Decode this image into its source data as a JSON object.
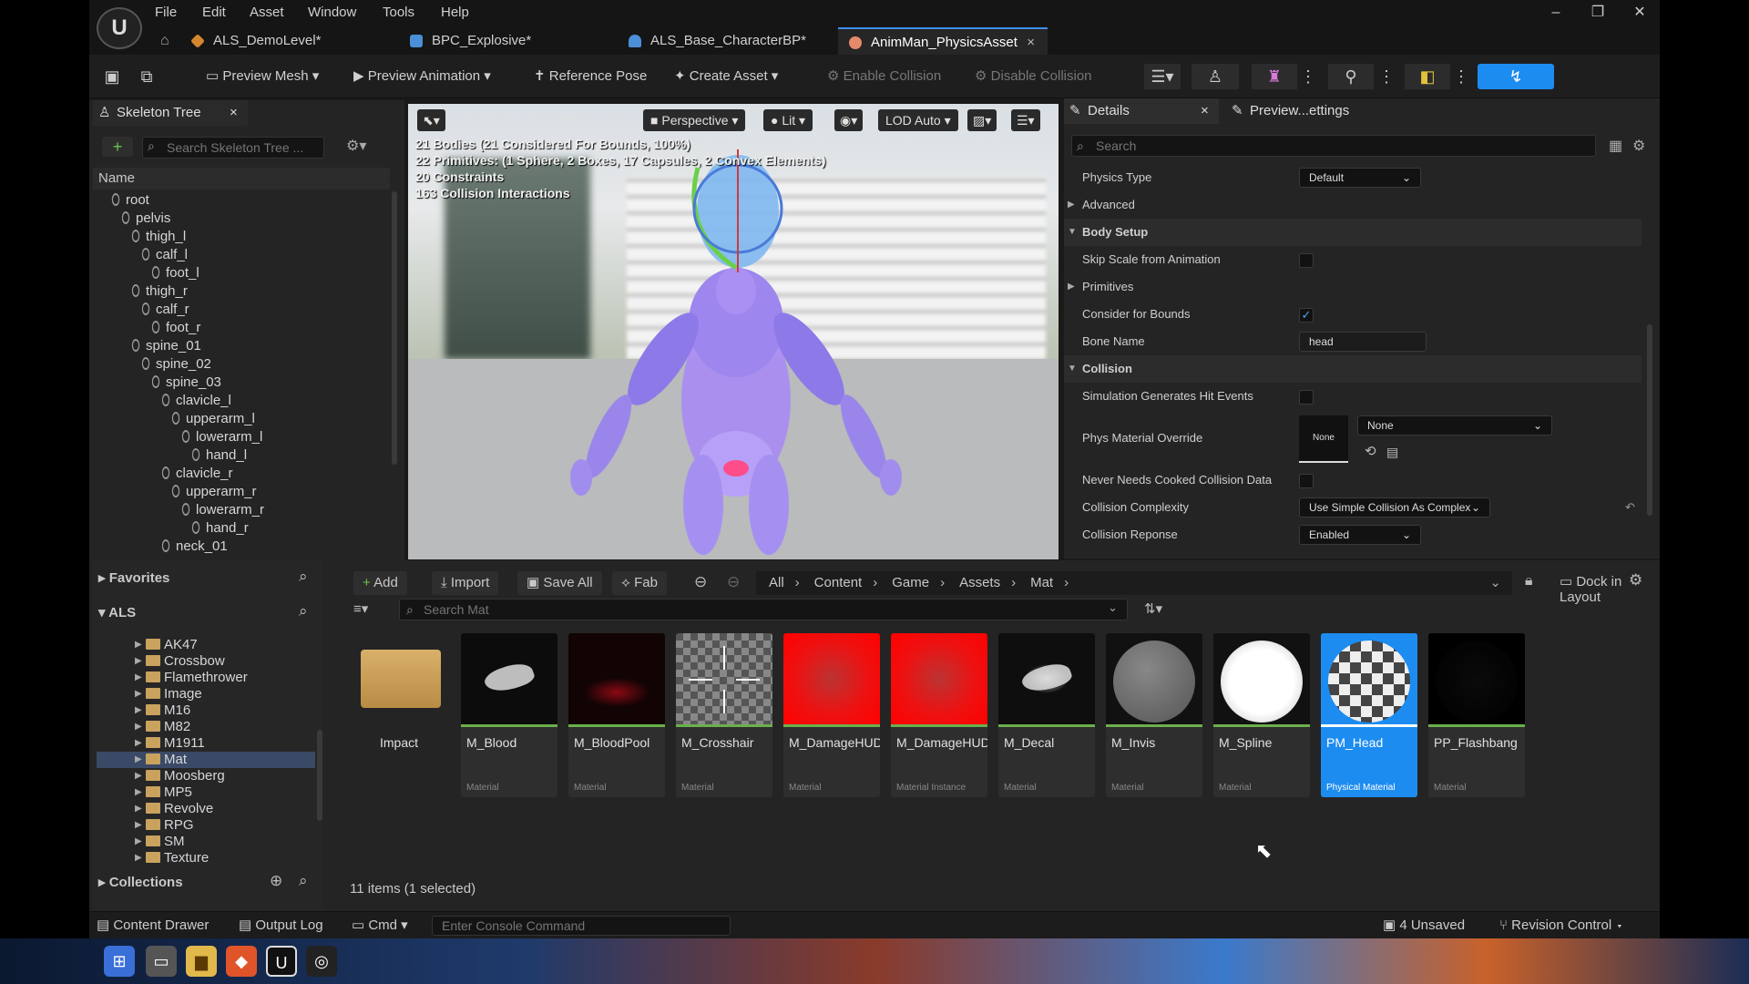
{
  "menu": [
    "File",
    "Edit",
    "Asset",
    "Window",
    "Tools",
    "Help"
  ],
  "logo_text": "U",
  "doc_tabs": [
    {
      "label": "ALS_DemoLevel*",
      "color": "#d4872e"
    },
    {
      "label": "BPC_Explosive*",
      "color": "#4a8fd8"
    },
    {
      "label": "ALS_Base_CharacterBP*",
      "color": "#4a8fd8"
    },
    {
      "label": "AnimMan_PhysicsAsset",
      "color": "#e58a6a",
      "active": true,
      "close": "×"
    }
  ],
  "window_controls": {
    "minimize": "–",
    "restore": "❐",
    "close": "✕"
  },
  "toolbar": {
    "preview_mesh": "Preview Mesh",
    "preview_animation": "Preview Animation",
    "reference_pose": "Reference Pose",
    "create_asset": "Create Asset",
    "enable_collision": "Enable Collision",
    "disable_collision": "Disable Collision"
  },
  "skeleton_tree": {
    "tab": "Skeleton Tree",
    "close": "×",
    "search_placeholder": "Search Skeleton Tree ...",
    "column_header": "Name",
    "bones": [
      {
        "name": "root",
        "depth": 0
      },
      {
        "name": "pelvis",
        "depth": 1
      },
      {
        "name": "thigh_l",
        "depth": 2
      },
      {
        "name": "calf_l",
        "depth": 3
      },
      {
        "name": "foot_l",
        "depth": 4
      },
      {
        "name": "thigh_r",
        "depth": 2
      },
      {
        "name": "calf_r",
        "depth": 3
      },
      {
        "name": "foot_r",
        "depth": 4
      },
      {
        "name": "spine_01",
        "depth": 2
      },
      {
        "name": "spine_02",
        "depth": 3
      },
      {
        "name": "spine_03",
        "depth": 4
      },
      {
        "name": "clavicle_l",
        "depth": 5
      },
      {
        "name": "upperarm_l",
        "depth": 6
      },
      {
        "name": "lowerarm_l",
        "depth": 7
      },
      {
        "name": "hand_l",
        "depth": 8
      },
      {
        "name": "clavicle_r",
        "depth": 5
      },
      {
        "name": "upperarm_r",
        "depth": 6
      },
      {
        "name": "lowerarm_r",
        "depth": 7
      },
      {
        "name": "hand_r",
        "depth": 8
      },
      {
        "name": "neck_01",
        "depth": 5
      }
    ]
  },
  "viewport": {
    "perspective": "Perspective",
    "lit": "Lit",
    "lod": "LOD Auto",
    "stats": [
      "21 Bodies (21 Considered For Bounds, 100%)",
      "22 Primitives: (1 Sphere, 2 Boxes, 17 Capsules, 2 Convex Elements)",
      "20 Constraints",
      "163 Collision Interactions"
    ]
  },
  "details": {
    "tab": "Details",
    "close": "×",
    "tab2": "Preview...ettings",
    "search_placeholder": "Search",
    "physics_type_label": "Physics Type",
    "physics_type_value": "Default",
    "advanced": "Advanced",
    "body_setup": "Body Setup",
    "skip_scale_label": "Skip Scale from Animation",
    "primitives": "Primitives",
    "consider_bounds_label": "Consider for Bounds",
    "bone_name_label": "Bone Name",
    "bone_name_value": "head",
    "collision": "Collision",
    "sim_hit_label": "Simulation Generates Hit Events",
    "phys_mat_label": "Phys Material Override",
    "phys_mat_thumb": "None",
    "phys_mat_value": "None",
    "never_cooked_label": "Never Needs Cooked Collision Data",
    "complexity_label": "Collision Complexity",
    "complexity_value": "Use Simple Collision As Complex",
    "response_label": "Collision Reponse",
    "response_value": "Enabled"
  },
  "content_browser": {
    "favorites": "Favorites",
    "root": "ALS",
    "folders": [
      "AK47",
      "Crossbow",
      "Flamethrower",
      "Image",
      "M16",
      "M82",
      "M1911",
      "Mat",
      "Moosberg",
      "MP5",
      "Revolve",
      "RPG",
      "SM",
      "Texture"
    ],
    "selected_folder": "Mat",
    "collections": "Collections",
    "add": "Add",
    "import": "Import",
    "save_all": "Save All",
    "fab": "Fab",
    "breadcrumb": [
      "All",
      "Content",
      "Game",
      "Assets",
      "Mat"
    ],
    "search_placeholder": "Search Mat",
    "dock_in_layout": "Dock in Layout",
    "item_count": "11 items (1 selected)",
    "assets": [
      {
        "name": "Impact",
        "type": "",
        "kind": "folder"
      },
      {
        "name": "M_Blood",
        "type": "Material",
        "kind": "blood"
      },
      {
        "name": "M_BloodPool",
        "type": "Material",
        "kind": "bloodpool"
      },
      {
        "name": "M_Crosshair",
        "type": "Material",
        "kind": "crosshair"
      },
      {
        "name": "M_DamageHUD",
        "type": "Material",
        "kind": "damage"
      },
      {
        "name": "M_DamageHUD_Inst",
        "type": "Material Instance",
        "kind": "damage"
      },
      {
        "name": "M_Decal",
        "type": "Material",
        "kind": "decal"
      },
      {
        "name": "M_Invis",
        "type": "Material",
        "kind": "invis"
      },
      {
        "name": "M_Spline",
        "type": "Material",
        "kind": "spline"
      },
      {
        "name": "PM_Head",
        "type": "Physical Material",
        "kind": "physmat",
        "selected": true
      },
      {
        "name": "PP_Flashbang",
        "type": "Material",
        "kind": "flash"
      }
    ]
  },
  "statusbar": {
    "content_drawer": "Content Drawer",
    "output_log": "Output Log",
    "cmd": "Cmd",
    "console_placeholder": "Enter Console Command",
    "unsaved": "4 Unsaved",
    "revision_control": "Revision Control"
  }
}
